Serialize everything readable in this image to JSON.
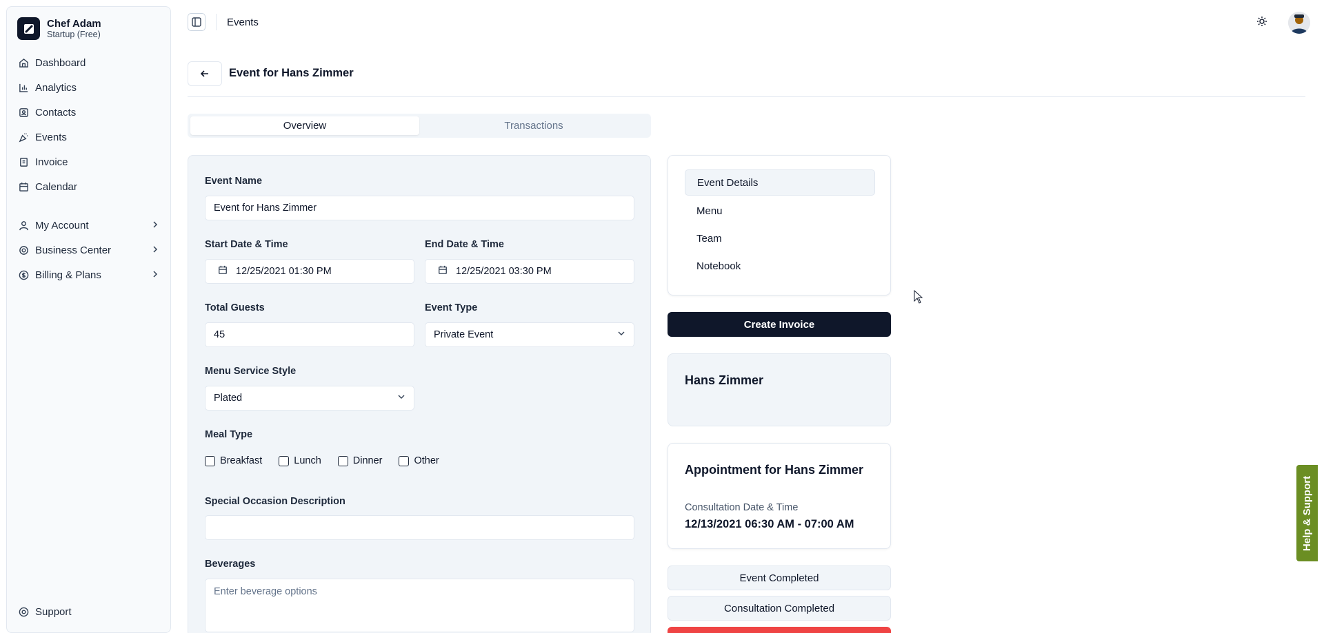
{
  "brand": {
    "name": "Chef Adam",
    "plan": "Startup (Free)"
  },
  "sidebar": {
    "items": [
      {
        "label": "Dashboard",
        "icon": "home-icon"
      },
      {
        "label": "Analytics",
        "icon": "bar-chart-icon"
      },
      {
        "label": "Contacts",
        "icon": "contacts-icon"
      },
      {
        "label": "Events",
        "icon": "party-popper-icon"
      },
      {
        "label": "Invoice",
        "icon": "receipt-icon"
      },
      {
        "label": "Calendar",
        "icon": "calendar-icon"
      }
    ],
    "groups": [
      {
        "label": "My Account",
        "icon": "user-icon"
      },
      {
        "label": "Business Center",
        "icon": "gear-icon"
      },
      {
        "label": "Billing & Plans",
        "icon": "dollar-icon"
      }
    ],
    "support": "Support"
  },
  "topbar": {
    "breadcrumb": "Events"
  },
  "page": {
    "title": "Event for Hans Zimmer"
  },
  "tabs": [
    "Overview",
    "Transactions"
  ],
  "form": {
    "event_name_label": "Event Name",
    "event_name": "Event for Hans Zimmer",
    "start_label": "Start Date & Time",
    "start_value": "12/25/2021 01:30 PM",
    "end_label": "End Date & Time",
    "end_value": "12/25/2021 03:30 PM",
    "guests_label": "Total Guests",
    "guests_value": "45",
    "event_type_label": "Event Type",
    "event_type_value": "Private Event",
    "service_label": "Menu Service Style",
    "service_value": "Plated",
    "meal_label": "Meal Type",
    "meals": [
      "Breakfast",
      "Lunch",
      "Dinner",
      "Other"
    ],
    "occasion_label": "Special Occasion Description",
    "occasion_value": "",
    "beverages_label": "Beverages",
    "beverages_placeholder": "Enter beverage options"
  },
  "section_nav": [
    "Event Details",
    "Menu",
    "Team",
    "Notebook"
  ],
  "actions": {
    "create_invoice": "Create Invoice",
    "event_completed": "Event Completed",
    "consultation_completed": "Consultation Completed"
  },
  "client": {
    "name": "Hans Zimmer"
  },
  "appointment": {
    "title": "Appointment for Hans Zimmer",
    "label": "Consultation Date & Time",
    "value": "12/13/2021 06:30 AM - 07:00 AM"
  },
  "help": "Help & Support",
  "colors": {
    "primary": "#0f172a",
    "danger": "#ef4444",
    "help": "#6b8e23"
  }
}
